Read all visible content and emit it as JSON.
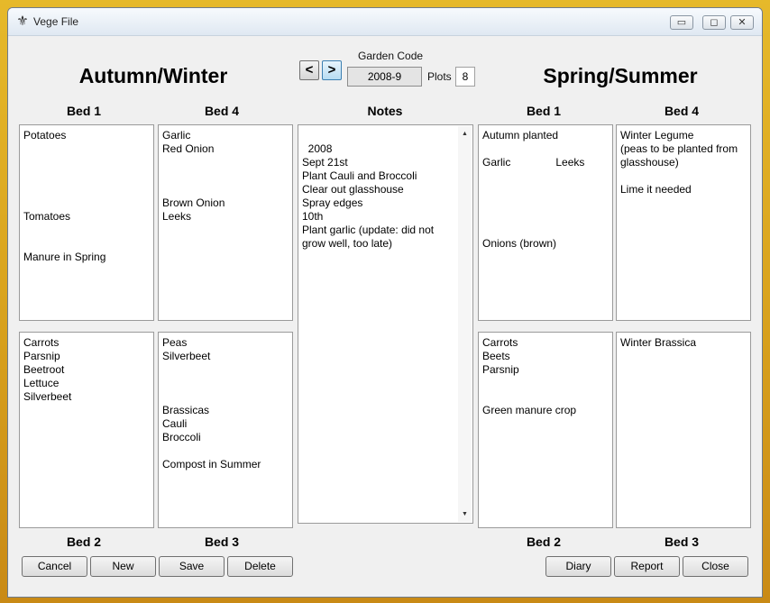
{
  "window": {
    "title": "Vege File",
    "icon": "fleur-de-lis-icon"
  },
  "window_controls": {
    "minimize": "▭",
    "maximize": "◻",
    "close": "✕"
  },
  "header": {
    "left_heading": "Autumn/Winter",
    "right_heading": "Spring/Summer",
    "garden_code_label": "Garden Code",
    "garden_code_value": "2008-9",
    "prev_label": "<",
    "next_label": ">",
    "plots_label": "Plots",
    "plots_value": "8"
  },
  "notes": {
    "heading": "Notes",
    "text": "2008\nSept 21st\nPlant Cauli and Broccoli\nClear out glasshouse\nSpray edges\n10th\nPlant garlic (update: did not\ngrow well, too late)"
  },
  "autumn_winter": {
    "bed1": {
      "label": "Bed 1",
      "text": "Potatoes\n\n\n\n\n\nTomatoes\n\n\nManure in Spring"
    },
    "bed4": {
      "label": "Bed 4",
      "text": "Garlic\nRed Onion\n\n\n\nBrown Onion\nLeeks"
    },
    "bed2": {
      "label": "Bed 2",
      "text": "Carrots\nParsnip\nBeetroot\nLettuce\nSilverbeet"
    },
    "bed3": {
      "label": "Bed 3",
      "text": "Peas\nSilverbeet\n\n\n\nBrassicas\nCauli\nBroccoli\n\nCompost in Summer"
    }
  },
  "spring_summer": {
    "bed1": {
      "label": "Bed 1",
      "text": "Autumn planted\n\nGarlic               Leeks\n\n\n\n\n\nOnions (brown)"
    },
    "bed4": {
      "label": "Bed 4",
      "text": "Winter Legume\n(peas to be planted from\nglasshouse)\n\nLime it needed"
    },
    "bed2": {
      "label": "Bed 2",
      "text": "Carrots\nBeets\nParsnip\n\n\nGreen manure crop"
    },
    "bed3": {
      "label": "Bed 3",
      "text": "Winter Brassica"
    }
  },
  "buttons": {
    "cancel": "Cancel",
    "new": "New",
    "save": "Save",
    "delete": "Delete",
    "diary": "Diary",
    "report": "Report",
    "close": "Close"
  }
}
